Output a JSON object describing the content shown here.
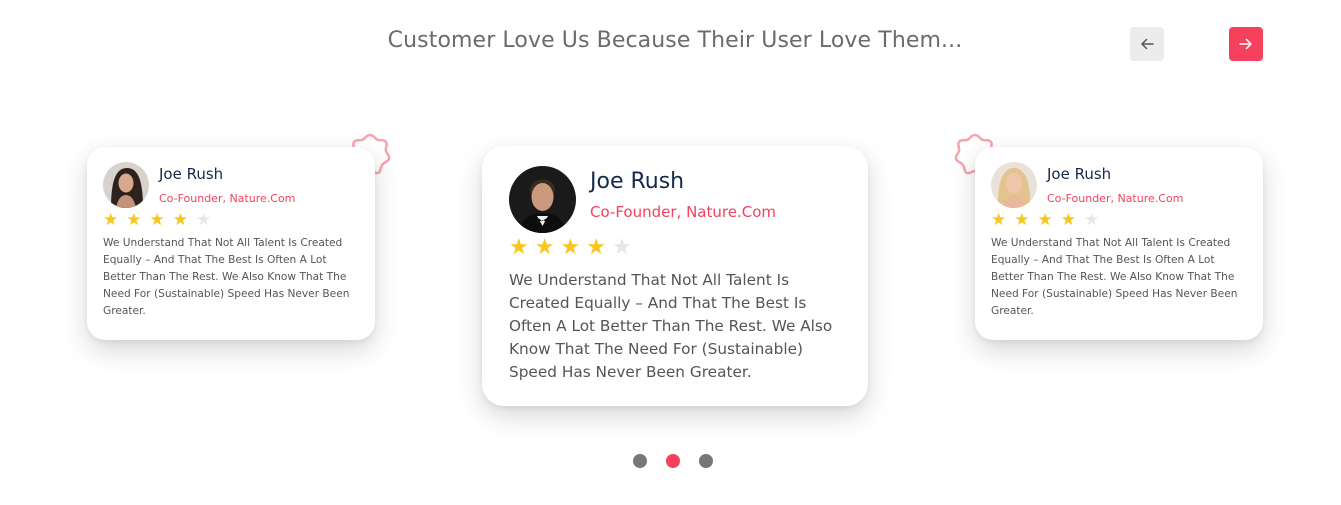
{
  "heading": "Customer Love Us Because Their User Love Them...",
  "nav": {
    "prev_icon": "arrow-left-icon",
    "next_icon": "arrow-right-icon"
  },
  "colors": {
    "accent": "#f5415c",
    "name": "#152a4a",
    "star_on": "#f8c61d",
    "star_off": "#e6e6e6",
    "dot_inactive": "#777777"
  },
  "testimonials": [
    {
      "name": "Joe Rush",
      "role": "Co-Founder, Nature.Com",
      "rating": 4,
      "max_rating": 5,
      "text": "We Understand That Not All Talent Is Created Equally – And That The Best Is Often A Lot Better Than The Rest. We Also Know That The Need For (Sustainable) Speed Has Never Been Greater."
    },
    {
      "name": "Joe Rush",
      "role": "Co-Founder, Nature.Com",
      "rating": 4,
      "max_rating": 5,
      "text": "We Understand That Not All Talent Is Created Equally – And That The Best Is Often A Lot Better Than The Rest. We Also Know That The Need For (Sustainable) Speed Has Never Been Greater."
    },
    {
      "name": "Joe Rush",
      "role": "Co-Founder, Nature.Com",
      "rating": 4,
      "max_rating": 5,
      "text": "We Understand That Not All Talent Is Created Equally – And That The Best Is Often A Lot Better Than The Rest. We Also Know That The Need For (Sustainable) Speed Has Never Been Greater."
    }
  ],
  "pagination": {
    "count": 3,
    "active": 2
  }
}
